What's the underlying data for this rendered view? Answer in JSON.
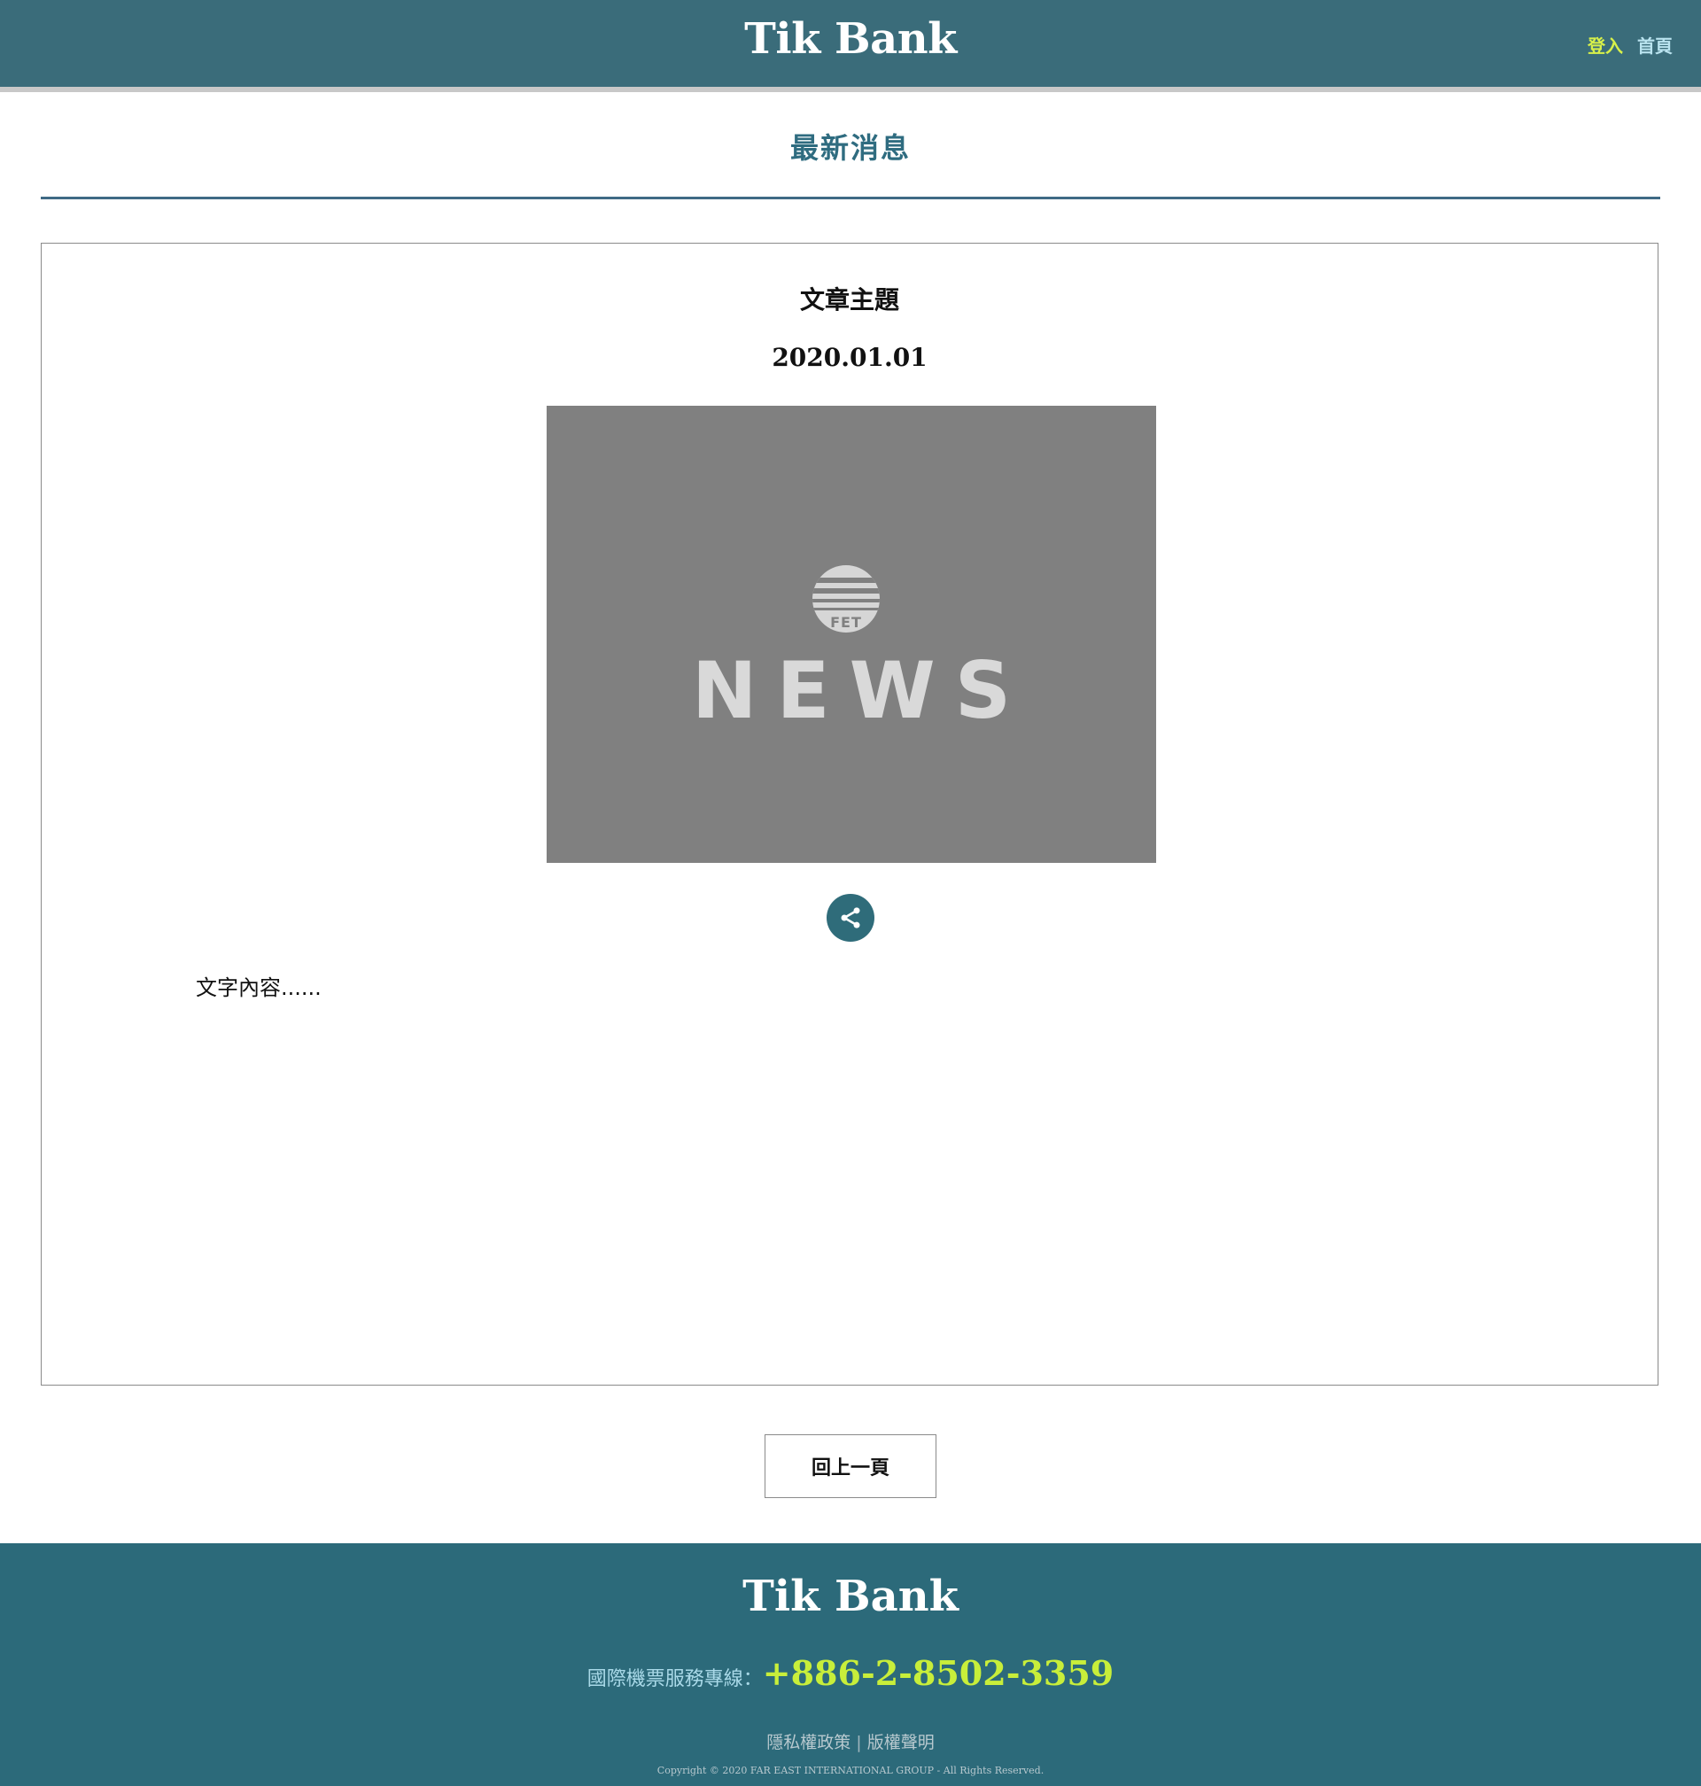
{
  "header": {
    "brand": "Tik Bank",
    "nav": {
      "login": "登入",
      "home": "首頁"
    }
  },
  "section": {
    "title": "最新消息"
  },
  "article": {
    "title": "文章主題",
    "date": "2020.01.01",
    "image": {
      "logo_text": "FET",
      "word": "NEWS"
    },
    "share_icon": "share-icon",
    "body": "文字內容......"
  },
  "back_button": {
    "label": "回上一頁"
  },
  "footer": {
    "brand": "Tik Bank",
    "phone_label": "國際機票服務專線：",
    "phone_number": "+886-2-8502-3359",
    "links": {
      "privacy": "隱私權政策",
      "separator": "|",
      "copyright": "版權聲明"
    },
    "copyright_text": "Copyright © 2020 FAR EAST INTERNATIONAL GROUP - All Rights Reserved."
  },
  "colors": {
    "header_bg": "#3a6c7a",
    "footer_bg": "#2c6a7a",
    "accent_green": "#c8ee3a",
    "title_teal": "#2f6c80"
  }
}
